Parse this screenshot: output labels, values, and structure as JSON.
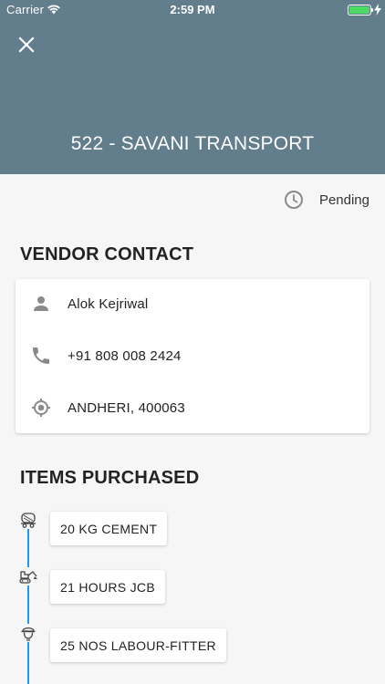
{
  "status_bar": {
    "carrier": "Carrier",
    "time": "2:59 PM",
    "battery_color": "#4cd964"
  },
  "header": {
    "title": "522 - SAVANI TRANSPORT",
    "background": "#627d8b",
    "close_icon": "close-icon"
  },
  "order_status": {
    "icon": "clock-icon",
    "label": "Pending"
  },
  "vendor_contact": {
    "title": "VENDOR CONTACT",
    "rows": [
      {
        "icon": "person-icon",
        "text": "Alok Kejriwal"
      },
      {
        "icon": "phone-icon",
        "text": "+91 808 008 2424"
      },
      {
        "icon": "location-icon",
        "text": "ANDHERI, 400063"
      }
    ]
  },
  "items_purchased": {
    "title": "ITEMS PURCHASED",
    "timeline_color": "#2196f3",
    "items": [
      {
        "icon": "mixer-truck-icon",
        "label": "20 KG CEMENT"
      },
      {
        "icon": "jcb-excavator-icon",
        "label": "21 HOURS JCB"
      },
      {
        "icon": "worker-helmet-icon",
        "label": "25 NOS LABOUR-FITTER"
      }
    ]
  }
}
